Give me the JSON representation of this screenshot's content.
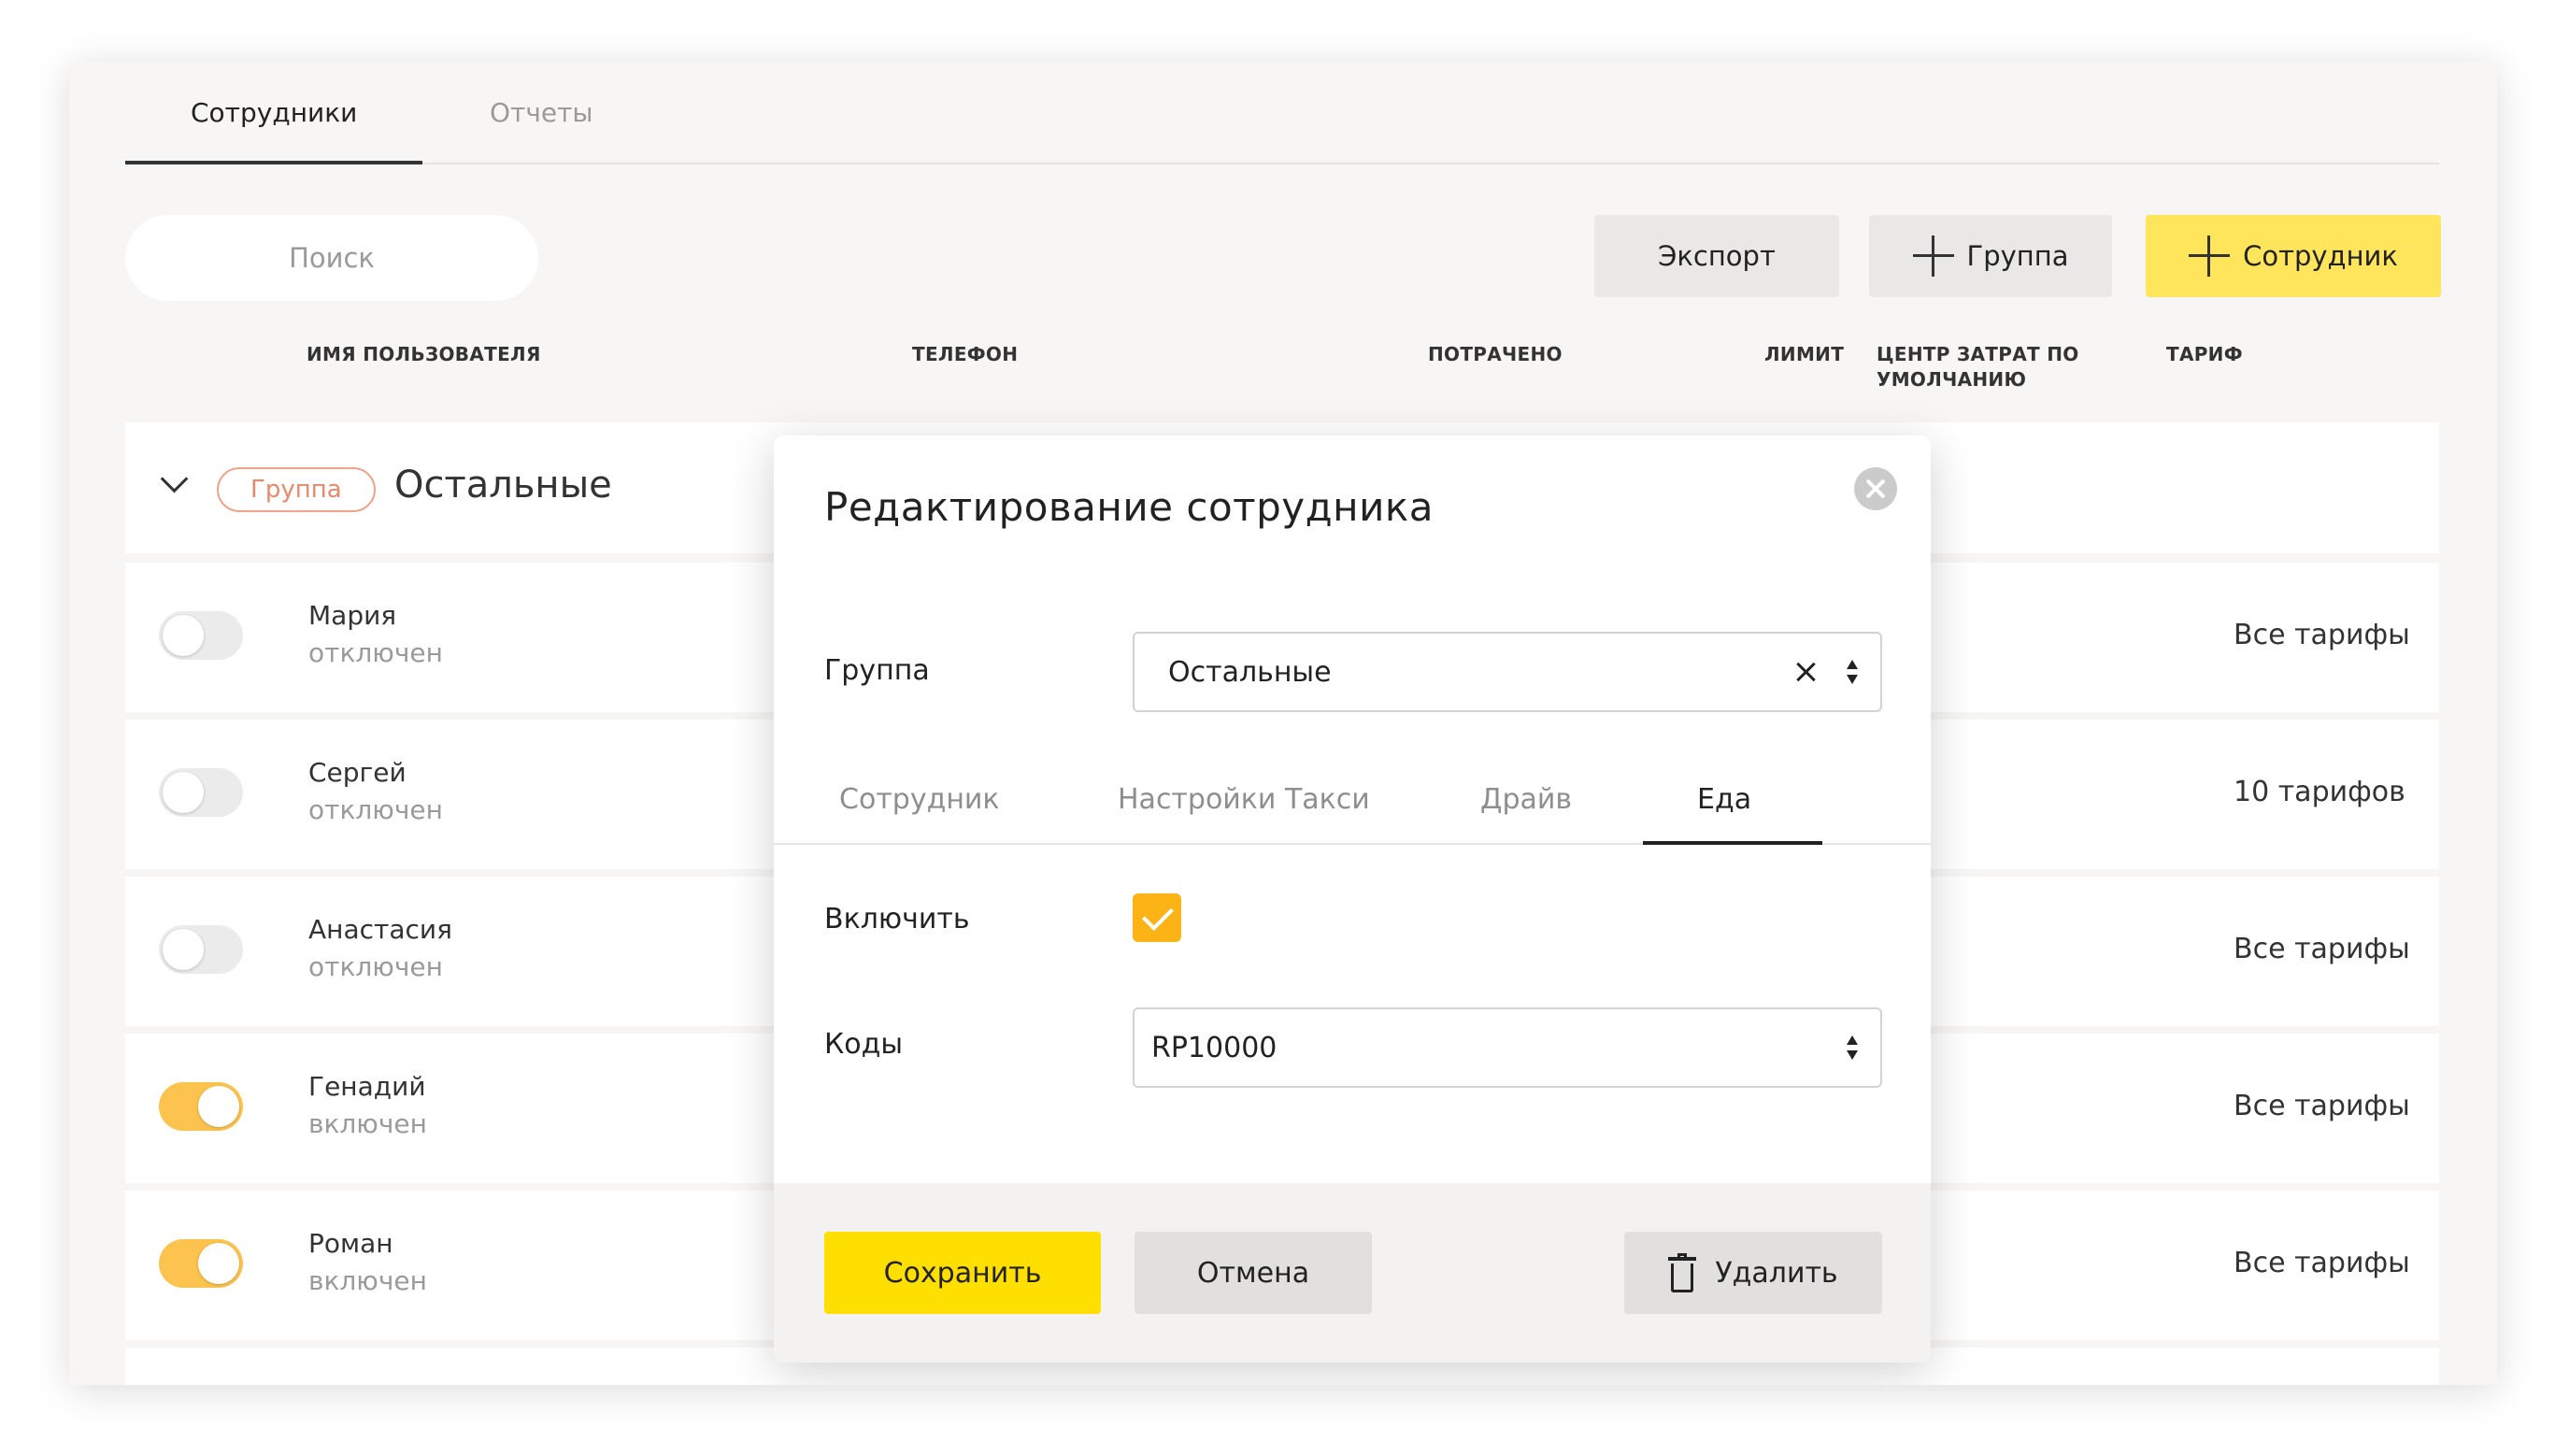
{
  "tabs": [
    {
      "label": "Сотрудники",
      "active": true
    },
    {
      "label": "Отчеты",
      "active": false
    }
  ],
  "search": {
    "placeholder": "Поиск"
  },
  "toolbar": {
    "export_label": "Экспорт",
    "add_group_label": "Группа",
    "add_employee_label": "Сотрудник"
  },
  "table": {
    "columns": {
      "username": "ИМЯ ПОЛЬЗОВАТЕЛЯ",
      "phone": "ТЕЛЕФОН",
      "spent": "ПОТРАЧЕНО",
      "limit": "ЛИМИТ",
      "cost_center": "ЦЕНТР ЗАТРАТ ПО УМОЛЧАНИЮ",
      "tariff": "ТАРИФ"
    },
    "group": {
      "badge": "Группа",
      "name": "Остальные"
    },
    "rows": [
      {
        "name": "Мария",
        "status": "отключен",
        "enabled": false,
        "cost_center": "—",
        "tariff": "Все тарифы"
      },
      {
        "name": "Сергей",
        "status": "отключен",
        "enabled": false,
        "cost_center": "—",
        "tariff": "10 тарифов"
      },
      {
        "name": "Анастасия",
        "status": "отключен",
        "enabled": false,
        "cost_center": "—",
        "tariff": "Все тарифы"
      },
      {
        "name": "Генадий",
        "status": "включен",
        "enabled": true,
        "cost_center": "—",
        "tariff": "Все тарифы"
      },
      {
        "name": "Роман",
        "status": "включен",
        "enabled": true,
        "cost_center": "—",
        "tariff": "Все тарифы"
      }
    ]
  },
  "modal": {
    "title": "Редактирование сотрудника",
    "group_label": "Группа",
    "group_value": "Остальные",
    "tabs": [
      {
        "label": "Сотрудник",
        "active": false
      },
      {
        "label": "Настройки Такси",
        "active": false
      },
      {
        "label": "Драйв",
        "active": false
      },
      {
        "label": "Еда",
        "active": true
      }
    ],
    "enable_label": "Включить",
    "enable_checked": true,
    "codes_label": "Коды",
    "codes_value": "RP10000",
    "save_label": "Сохранить",
    "cancel_label": "Отмена",
    "delete_label": "Удалить"
  },
  "colors": {
    "accent_yellow": "#ffe55c",
    "save_yellow": "#ffdf00",
    "toggle_on": "#fcc34f",
    "checkbox": "#fbb316",
    "group_badge": "#e8896a"
  }
}
